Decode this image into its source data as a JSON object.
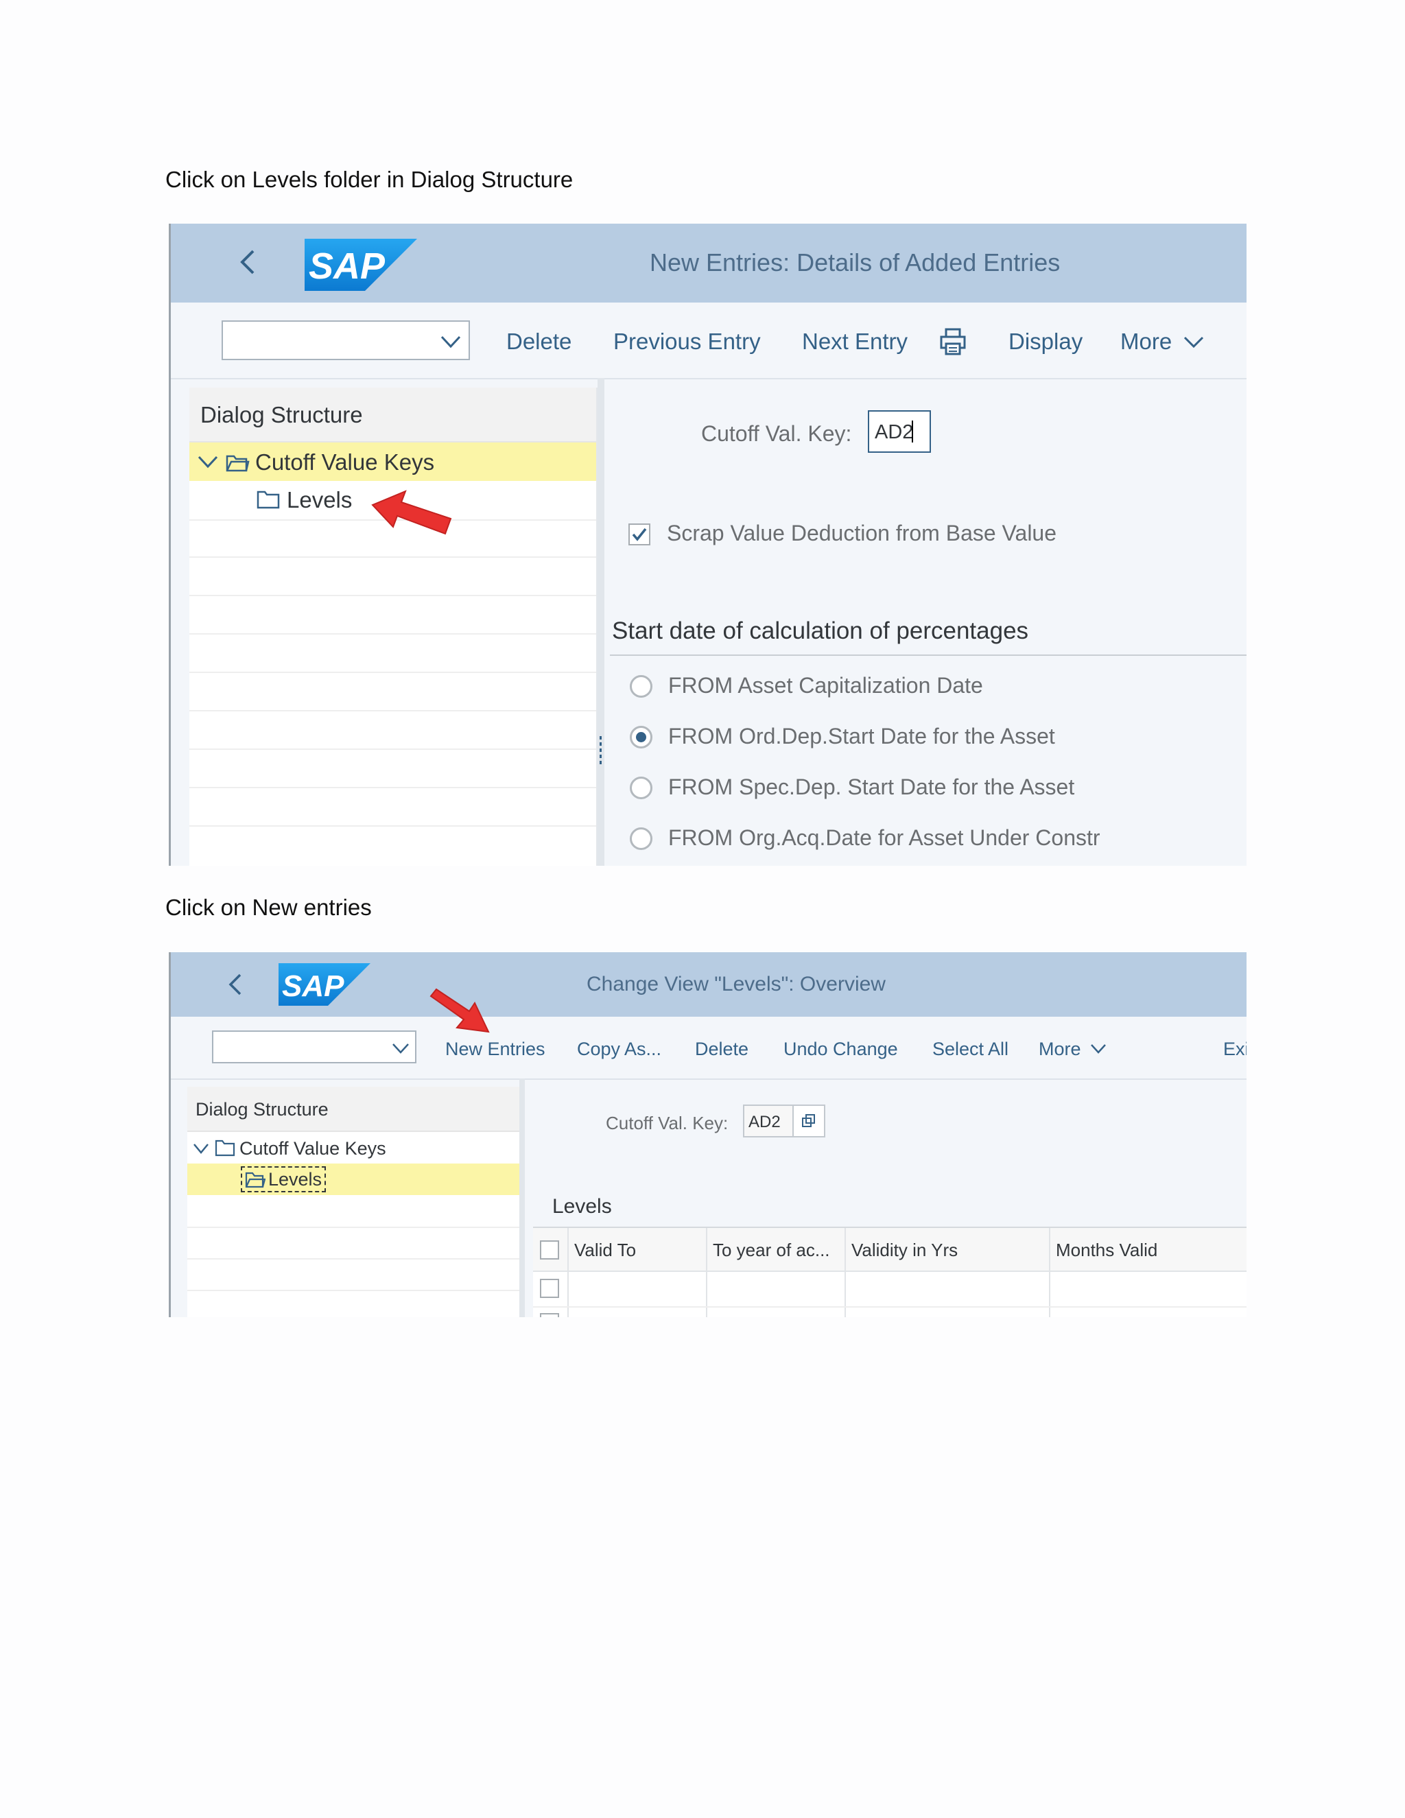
{
  "captions": {
    "first": "Click on Levels folder in Dialog Structure",
    "second": "Click on New entries"
  },
  "screen1": {
    "logo": "SAP",
    "title": "New Entries: Details of Added Entries",
    "toolbar": {
      "delete": "Delete",
      "previous_entry": "Previous Entry",
      "next_entry": "Next Entry",
      "print_icon": "printer-icon",
      "display": "Display",
      "more": "More"
    },
    "dialog_structure": {
      "header": "Dialog Structure",
      "cutoff_value_keys": "Cutoff Value Keys",
      "levels": "Levels"
    },
    "form": {
      "cutoff_key_label": "Cutoff Val. Key:",
      "cutoff_key_value": "AD2",
      "scrap_checkbox_label": "Scrap Value Deduction from Base Value",
      "scrap_checked": true,
      "section_title": "Start date of calculation of percentages",
      "options": [
        "FROM Asset Capitalization Date",
        "FROM Ord.Dep.Start Date for the Asset",
        "FROM Spec.Dep. Start Date for the Asset",
        "FROM Org.Acq.Date for Asset Under Constr"
      ],
      "selected_option": 1
    }
  },
  "screen2": {
    "logo": "SAP",
    "title": "Change View \"Levels\": Overview",
    "toolbar": {
      "new_entries": "New Entries",
      "copy_as": "Copy As...",
      "delete": "Delete",
      "undo_change": "Undo Change",
      "select_all": "Select All",
      "more": "More",
      "exit": "Exi"
    },
    "dialog_structure": {
      "header": "Dialog Structure",
      "cutoff_value_keys": "Cutoff Value Keys",
      "levels": "Levels"
    },
    "form": {
      "cutoff_key_label": "Cutoff Val. Key:",
      "cutoff_key_value": "AD2",
      "table_title": "Levels",
      "columns": [
        "Valid To",
        "To year of ac...",
        "Validity in Yrs",
        "Months Valid"
      ]
    }
  },
  "colors": {
    "shell_bar": "#b7cce2",
    "highlight": "#fbf5a7",
    "link": "#346187",
    "arrow": "#e8312f",
    "sap_blue": "#1e8be0"
  }
}
